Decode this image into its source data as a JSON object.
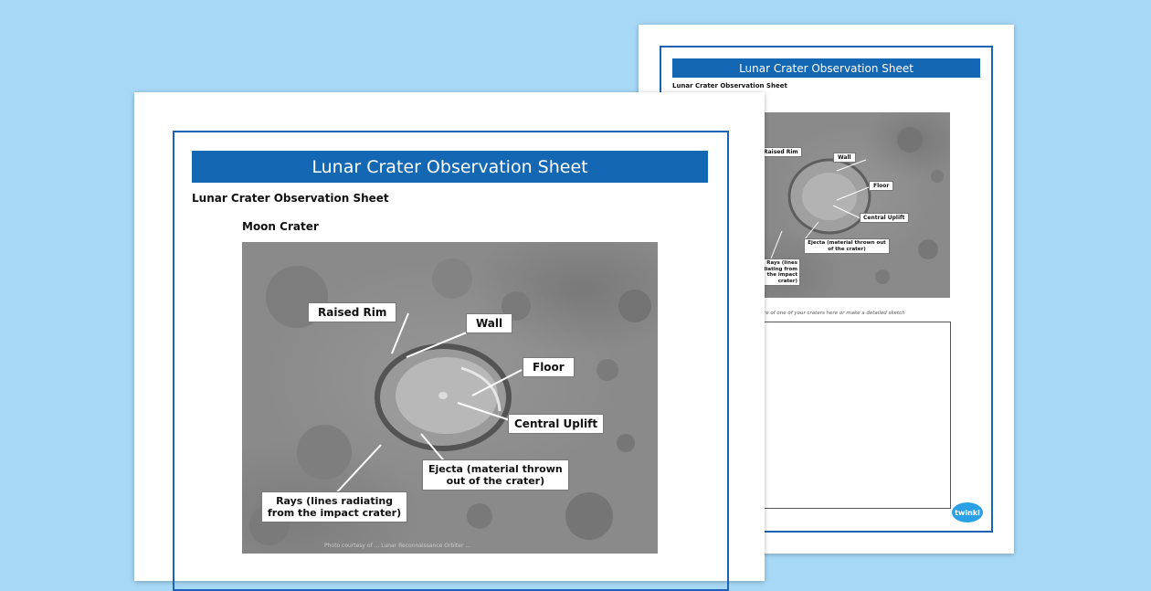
{
  "back_sheet": {
    "banner_title": "Lunar Crater Observation Sheet",
    "subtitle": "Lunar Crater Observation Sheet",
    "labels": {
      "raised_rim": "Raised Rim",
      "wall": "Wall",
      "floor": "Floor",
      "central_uplift": "Central Uplift",
      "ejecta": "Ejecta (material thrown out of the crater)",
      "rays": "Rays (lines radiating from the impact crater)"
    },
    "instruction": "...picture of one of your craters here or make a detailed sketch",
    "logo_text": "twinkl"
  },
  "front_sheet": {
    "banner_title": "Lunar Crater Observation Sheet",
    "subtitle": "Lunar Crater Observation Sheet",
    "image_heading": "Moon Crater",
    "labels": {
      "raised_rim": "Raised Rim",
      "wall": "Wall",
      "floor": "Floor",
      "central_uplift": "Central Uplift",
      "ejecta_line1": "Ejecta (material thrown",
      "ejecta_line2": "out of the crater)",
      "rays_line1": "Rays (lines radiating",
      "rays_line2": "from the impact crater)"
    },
    "photo_credit": "Photo courtesy of ... Lunar Reconnaissance Orbiter ... "
  },
  "colors": {
    "background": "#a7d9f7",
    "banner": "#1467b3",
    "frame_border": "#1a63b5"
  }
}
